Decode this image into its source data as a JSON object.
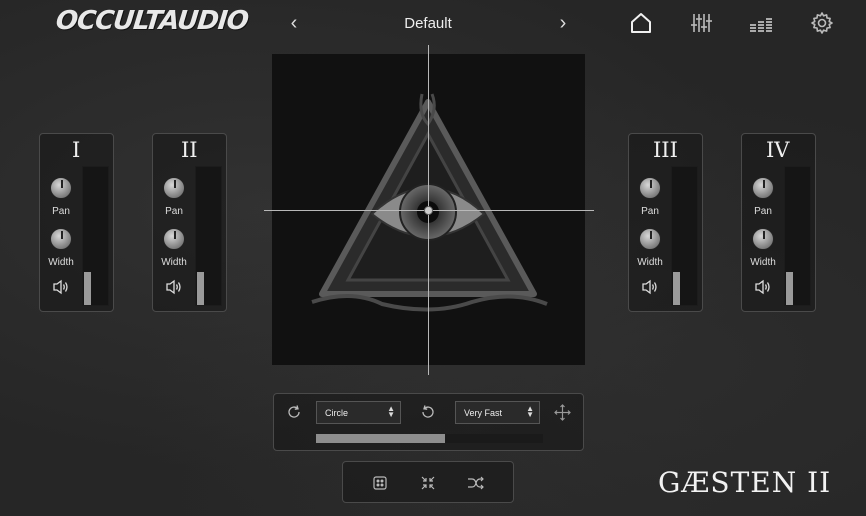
{
  "header": {
    "logo_text": "OCCULTAUDIO",
    "prev_preset": "‹",
    "next_preset": "›",
    "preset_name": "Default",
    "icons": [
      "home-icon",
      "mixer-sliders-icon",
      "level-bars-icon",
      "settings-gear-icon"
    ]
  },
  "channels": [
    {
      "title": "I",
      "pan_label": "Pan",
      "width_label": "Width",
      "level": 0.24
    },
    {
      "title": "II",
      "pan_label": "Pan",
      "width_label": "Width",
      "level": 0.24
    },
    {
      "title": "III",
      "pan_label": "Pan",
      "width_label": "Width",
      "level": 0.24
    },
    {
      "title": "IV",
      "pan_label": "Pan",
      "width_label": "Width",
      "level": 0.24
    }
  ],
  "xy_pad": {
    "artwork": "all-seeing-eye-triangle",
    "point_x": 0.5,
    "point_y": 0.5
  },
  "motion": {
    "shape_value": "Circle",
    "speed_value": "Very Fast",
    "progress": 0.57
  },
  "product_name": "GÆSTEN II",
  "colors": {
    "background": "#262626",
    "panel_border": "#4a4a4a",
    "accent": "#8e8e8e"
  }
}
